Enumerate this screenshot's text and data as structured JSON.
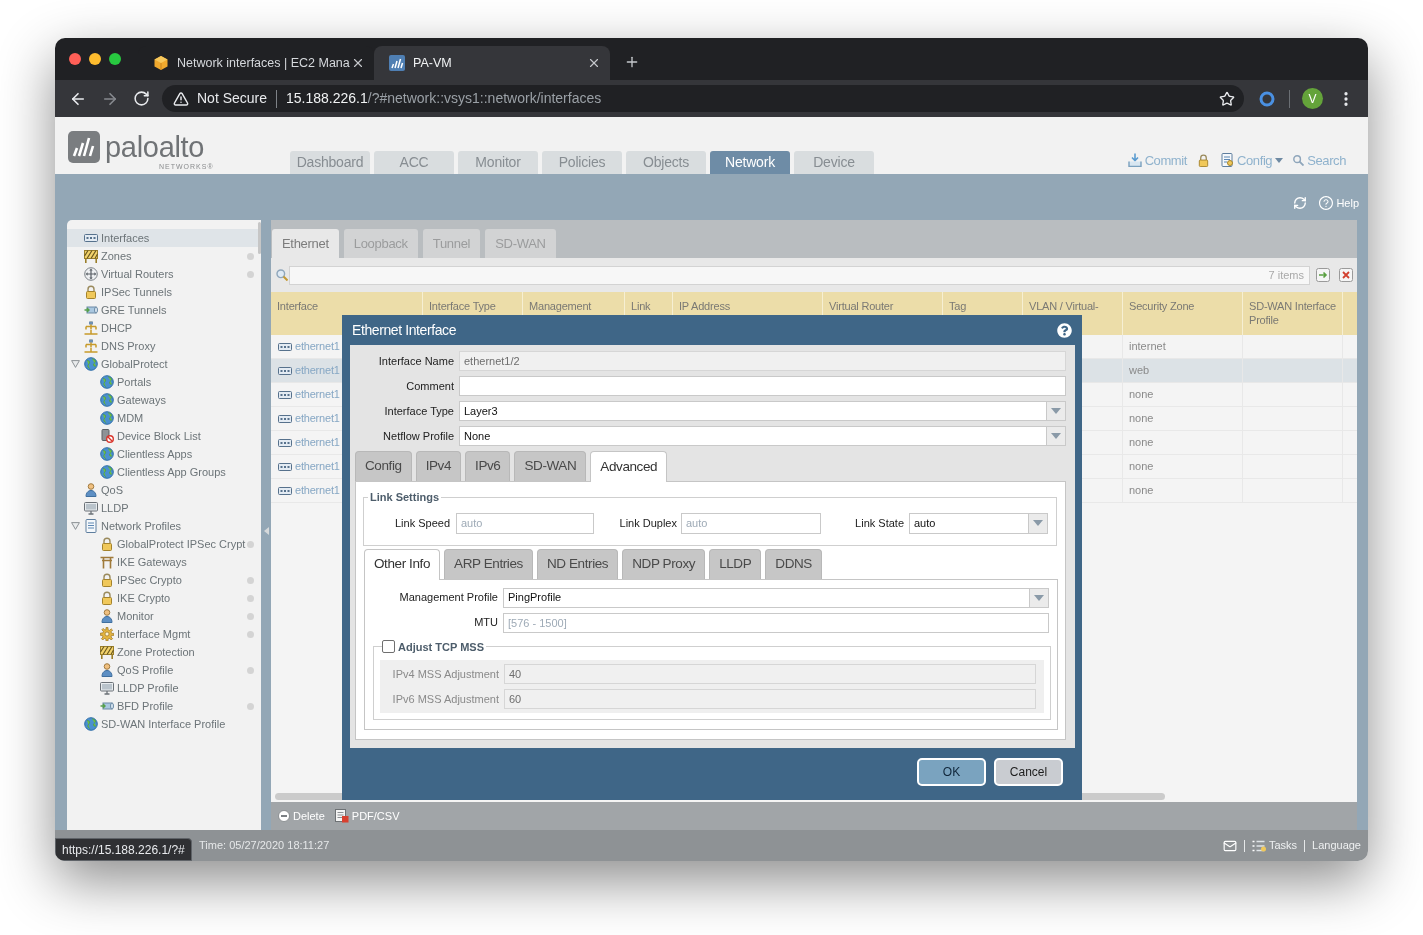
{
  "browser": {
    "tabs": [
      {
        "title": "Network interfaces | EC2 Mana",
        "selected": false
      },
      {
        "title": "PA-VM",
        "selected": true
      }
    ],
    "security": "Not Secure",
    "url_host": "15.188.226.1",
    "url_path": "/?#network::vsys1::network/interfaces",
    "profile_initial": "V",
    "status_link": "https://15.188.226.1/?#"
  },
  "app": {
    "logo": {
      "wordmark": "paloalto",
      "tagline": "NETWORKS®"
    },
    "nav_tabs": [
      {
        "label": "Dashboard",
        "selected": false
      },
      {
        "label": "ACC",
        "selected": false
      },
      {
        "label": "Monitor",
        "selected": false
      },
      {
        "label": "Policies",
        "selected": false
      },
      {
        "label": "Objects",
        "selected": false
      },
      {
        "label": "Network",
        "selected": true
      },
      {
        "label": "Device",
        "selected": false
      }
    ],
    "header_actions": [
      {
        "kind": "commit",
        "label": "Commit"
      },
      {
        "kind": "lock"
      },
      {
        "kind": "config",
        "label": "Config"
      },
      {
        "kind": "search",
        "label": "Search"
      }
    ],
    "help": {
      "label": "Help"
    },
    "sidebar": {
      "items": [
        {
          "label": "Interfaces",
          "selected": true,
          "indicator": false
        },
        {
          "label": "Zones",
          "selected": false,
          "indicator": true
        },
        {
          "label": "Virtual Routers",
          "selected": false,
          "indicator": true
        },
        {
          "label": "IPSec Tunnels",
          "selected": false,
          "indicator": false
        },
        {
          "label": "GRE Tunnels",
          "selected": false,
          "indicator": false
        },
        {
          "label": "DHCP",
          "selected": false,
          "indicator": false
        },
        {
          "label": "DNS Proxy",
          "selected": false,
          "indicator": false
        },
        {
          "label": "GlobalProtect",
          "selected": false,
          "indicator": false,
          "expanded": true,
          "children": [
            {
              "label": "Portals",
              "selected": false,
              "indicator": false
            },
            {
              "label": "Gateways",
              "selected": false,
              "indicator": false
            },
            {
              "label": "MDM",
              "selected": false,
              "indicator": false
            },
            {
              "label": "Device Block List",
              "selected": false,
              "indicator": false
            },
            {
              "label": "Clientless Apps",
              "selected": false,
              "indicator": false
            },
            {
              "label": "Clientless App Groups",
              "selected": false,
              "indicator": false
            }
          ]
        },
        {
          "label": "QoS",
          "selected": false,
          "indicator": false
        },
        {
          "label": "LLDP",
          "selected": false,
          "indicator": false
        },
        {
          "label": "Network Profiles",
          "selected": false,
          "indicator": false,
          "expanded": true,
          "children": [
            {
              "label": "GlobalProtect IPSec Crypt",
              "selected": false,
              "indicator": true
            },
            {
              "label": "IKE Gateways",
              "selected": false,
              "indicator": false
            },
            {
              "label": "IPSec Crypto",
              "selected": false,
              "indicator": true
            },
            {
              "label": "IKE Crypto",
              "selected": false,
              "indicator": true
            },
            {
              "label": "Monitor",
              "selected": false,
              "indicator": true
            },
            {
              "label": "Interface Mgmt",
              "selected": false,
              "indicator": true
            },
            {
              "label": "Zone Protection",
              "selected": false,
              "indicator": false
            },
            {
              "label": "QoS Profile",
              "selected": false,
              "indicator": true
            },
            {
              "label": "LLDP Profile",
              "selected": false,
              "indicator": false
            },
            {
              "label": "BFD Profile",
              "selected": false,
              "indicator": true
            }
          ]
        },
        {
          "label": "SD-WAN Interface Profile",
          "selected": false,
          "indicator": false
        }
      ]
    },
    "sub_tabs": [
      {
        "label": "Ethernet",
        "selected": true
      },
      {
        "label": "Loopback",
        "selected": false
      },
      {
        "label": "Tunnel",
        "selected": false
      },
      {
        "label": "SD-WAN",
        "selected": false
      }
    ],
    "filter": {
      "count": "7 items"
    },
    "table": {
      "columns": [
        "Interface",
        "Interface Type",
        "Management",
        "Link",
        "IP Address",
        "Virtual Router",
        "Tag",
        "VLAN / Virtual-",
        "Security Zone",
        "SD-WAN Interface Profile"
      ],
      "rows": [
        {
          "interface": "ethernet1",
          "security_zone": "internet",
          "selected": false
        },
        {
          "interface": "ethernet1",
          "security_zone": "web",
          "selected": true
        },
        {
          "interface": "ethernet1",
          "security_zone": "none",
          "selected": false
        },
        {
          "interface": "ethernet1",
          "security_zone": "none",
          "selected": false
        },
        {
          "interface": "ethernet1",
          "security_zone": "none",
          "selected": false
        },
        {
          "interface": "ethernet1",
          "security_zone": "none",
          "selected": false
        },
        {
          "interface": "ethernet1",
          "security_zone": "none",
          "selected": false
        }
      ]
    },
    "actions": [
      {
        "kind": "delete",
        "label": "Delete"
      },
      {
        "kind": "export",
        "label": "PDF/CSV"
      }
    ],
    "status_bar": {
      "login_time": "Time: 05/27/2020 18:11:27",
      "links": [
        {
          "kind": "tasks",
          "label": "Tasks"
        },
        {
          "kind": "language",
          "label": "Language"
        }
      ]
    }
  },
  "dialog": {
    "title": "Ethernet Interface",
    "fields": [
      {
        "kind": "text",
        "label": "Interface Name",
        "value": "ethernet1/2",
        "disabled": true
      },
      {
        "kind": "text",
        "label": "Comment",
        "disabled": false
      },
      {
        "kind": "select",
        "label": "Interface Type",
        "value": "Layer3"
      },
      {
        "kind": "select",
        "label": "Netflow Profile",
        "value": "None"
      }
    ],
    "tabs": [
      {
        "label": "Config",
        "selected": false
      },
      {
        "label": "IPv4",
        "selected": false
      },
      {
        "label": "IPv6",
        "selected": false
      },
      {
        "label": "SD-WAN",
        "selected": false
      },
      {
        "label": "Advanced",
        "selected": true
      }
    ],
    "link_settings": {
      "title": "Link Settings",
      "fields": [
        {
          "kind": "text",
          "label": "Link Speed",
          "placeholder": "auto"
        },
        {
          "kind": "text",
          "label": "Link Duplex",
          "placeholder": "auto"
        },
        {
          "kind": "select",
          "label": "Link State",
          "value": "auto"
        }
      ]
    },
    "inner_tabs": [
      {
        "label": "Other Info",
        "selected": true
      },
      {
        "label": "ARP Entries",
        "selected": false
      },
      {
        "label": "ND Entries",
        "selected": false
      },
      {
        "label": "NDP Proxy",
        "selected": false
      },
      {
        "label": "LLDP",
        "selected": false
      },
      {
        "label": "DDNS",
        "selected": false
      }
    ],
    "other_info": {
      "fields": [
        {
          "kind": "select",
          "label": "Management Profile",
          "value": "PingProfile"
        },
        {
          "kind": "text",
          "label": "MTU",
          "placeholder": "[576 - 1500]"
        }
      ],
      "adjust_tcp_mss": {
        "label": "Adjust TCP MSS",
        "checked": false,
        "fields": [
          {
            "label": "IPv4 MSS Adjustment",
            "value": "40"
          },
          {
            "label": "IPv6 MSS Adjustment",
            "value": "60"
          }
        ]
      }
    },
    "buttons": [
      {
        "kind": "primary",
        "label": "OK"
      },
      {
        "kind": "secondary",
        "label": "Cancel"
      }
    ]
  }
}
